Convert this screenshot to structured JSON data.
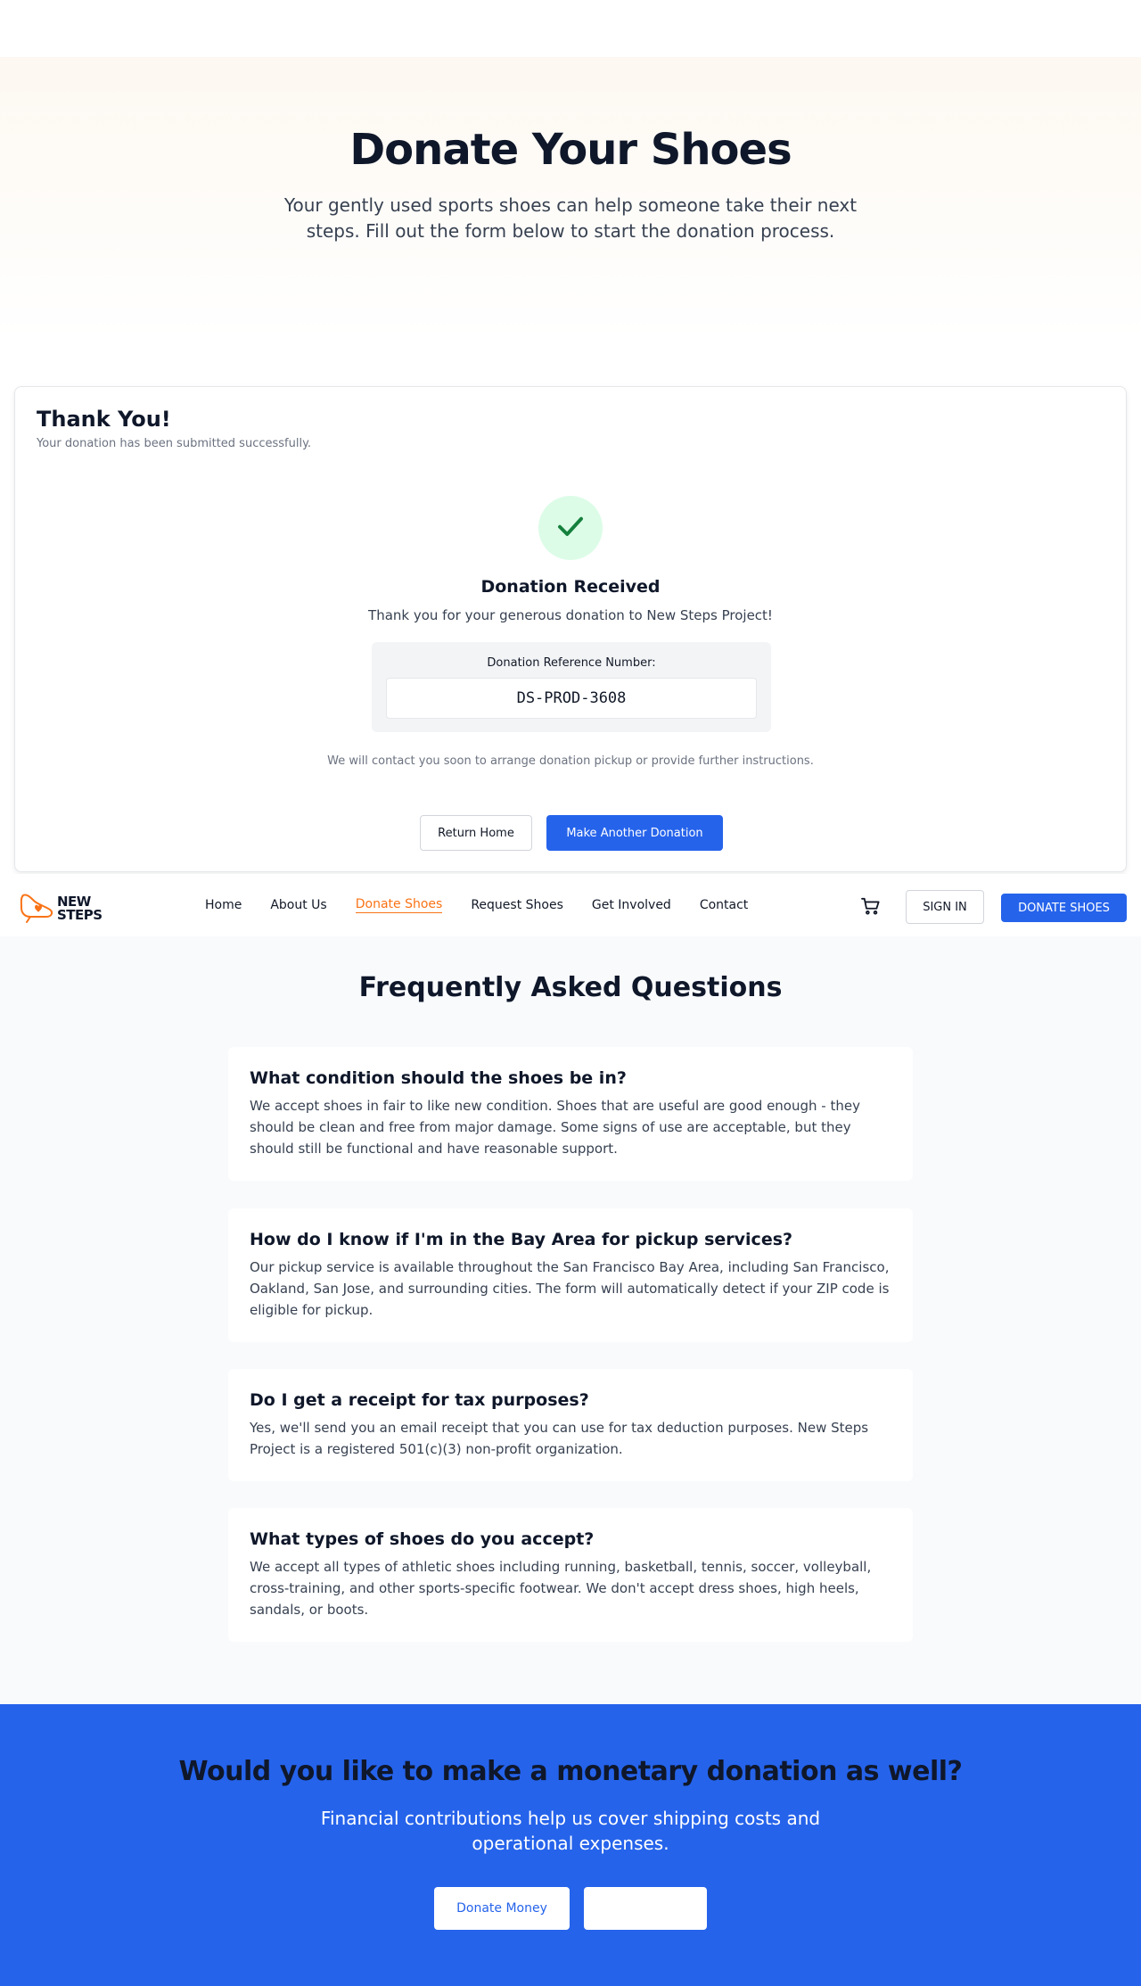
{
  "hero": {
    "title": "Donate Your Shoes",
    "subtitle": "Your gently used sports shoes can help someone take their next steps. Fill out the form below to start the donation process."
  },
  "confirmation": {
    "title": "Thank You!",
    "subtitle": "Your donation has been submitted successfully.",
    "icon": "checkmark-icon",
    "heading": "Donation Received",
    "message": "Thank you for your generous donation to New Steps Project!",
    "reference_label": "Donation Reference Number:",
    "reference_value": "DS-PROD-3608",
    "contact_note": "We will contact you soon to arrange donation pickup or provide further instructions.",
    "return_home_label": "Return Home",
    "another_donation_label": "Make Another Donation"
  },
  "nav": {
    "logo_line1": "NEW",
    "logo_line2": "STEPS",
    "links": [
      {
        "label": "Home",
        "active": false
      },
      {
        "label": "About Us",
        "active": false
      },
      {
        "label": "Donate Shoes",
        "active": true
      },
      {
        "label": "Request Shoes",
        "active": false
      },
      {
        "label": "Get Involved",
        "active": false
      },
      {
        "label": "Contact",
        "active": false
      }
    ],
    "cart_icon": "cart-icon",
    "sign_in_label": "SIGN IN",
    "donate_shoes_label": "DONATE SHOES"
  },
  "faq": {
    "title": "Frequently Asked Questions",
    "items": [
      {
        "question": "What condition should the shoes be in?",
        "answer": "We accept shoes in fair to like new condition. Shoes that are useful are good enough - they should be clean and free from major damage. Some signs of use are acceptable, but they should still be functional and have reasonable support."
      },
      {
        "question": "How do I know if I'm in the Bay Area for pickup services?",
        "answer": "Our pickup service is available throughout the San Francisco Bay Area, including San Francisco, Oakland, San Jose, and surrounding cities. The form will automatically detect if your ZIP code is eligible for pickup."
      },
      {
        "question": "Do I get a receipt for tax purposes?",
        "answer": "Yes, we'll send you an email receipt that you can use for tax deduction purposes. New Steps Project is a registered 501(c)(3) non-profit organization."
      },
      {
        "question": "What types of shoes do you accept?",
        "answer": "We accept all types of athletic shoes including running, basketball, tennis, soccer, volleyball, cross-training, and other sports-specific footwear. We don't accept dress shoes, high heels, sandals, or boots."
      }
    ]
  },
  "cta": {
    "title": "Would you like to make a monetary donation as well?",
    "text": "Financial contributions help us cover shipping costs and operational expenses.",
    "donate_money_label": "Donate Money",
    "second_button_label": ""
  },
  "colors": {
    "primary": "#2563eb",
    "accent": "#f97316",
    "success_bg": "#dcfce7",
    "success": "#15803d"
  }
}
